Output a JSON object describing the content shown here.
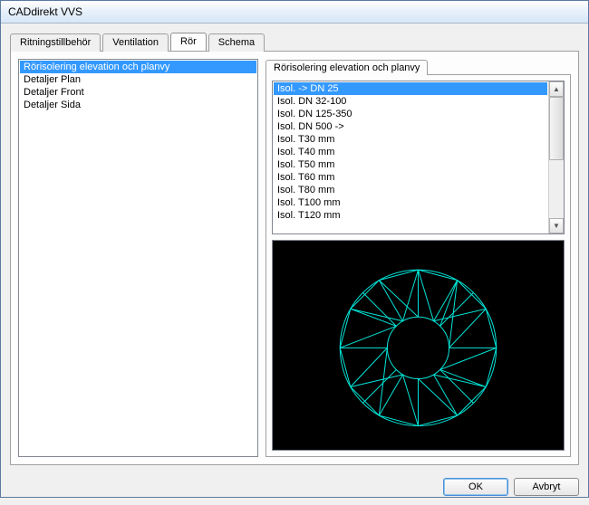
{
  "window": {
    "title": "CADdirekt VVS"
  },
  "tabs": [
    {
      "label": "Ritningstillbehör"
    },
    {
      "label": "Ventilation"
    },
    {
      "label": "Rör"
    },
    {
      "label": "Schema"
    }
  ],
  "active_tab_index": 2,
  "categories": [
    {
      "label": "Rörisolering elevation och planvy",
      "selected": true
    },
    {
      "label": "Detaljer Plan"
    },
    {
      "label": "Detaljer Front"
    },
    {
      "label": "Detaljer Sida"
    }
  ],
  "inner_tab": {
    "label": "Rörisolering elevation och planvy"
  },
  "detail_items": [
    {
      "label": "Isol. -> DN 25",
      "selected": true
    },
    {
      "label": "Isol. DN 32-100"
    },
    {
      "label": "Isol. DN 125-350"
    },
    {
      "label": "Isol. DN 500 ->"
    },
    {
      "label": "Isol. T30 mm"
    },
    {
      "label": "Isol. T40 mm"
    },
    {
      "label": "Isol. T50 mm"
    },
    {
      "label": "Isol. T60 mm"
    },
    {
      "label": "Isol. T80 mm"
    },
    {
      "label": "Isol. T100 mm"
    },
    {
      "label": "Isol. T120 mm"
    }
  ],
  "buttons": {
    "ok": "OK",
    "cancel": "Avbryt"
  },
  "preview": {
    "stroke": "#00e5d8"
  }
}
